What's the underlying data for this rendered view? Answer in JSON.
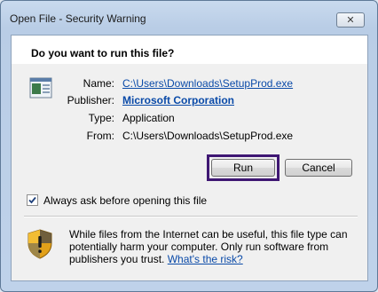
{
  "window": {
    "title": "Open File - Security Warning",
    "close_glyph": "✕"
  },
  "header": {
    "question": "Do you want to run this file?"
  },
  "file_info": {
    "icon": "application-file-icon",
    "name_label": "Name:",
    "name_value": "C:\\Users\\Downloads\\SetupProd.exe",
    "publisher_label": "Publisher:",
    "publisher_value": "Microsoft Corporation",
    "type_label": "Type:",
    "type_value": "Application",
    "from_label": "From:",
    "from_value": "C:\\Users\\Downloads\\SetupProd.exe"
  },
  "buttons": {
    "run_label": "Run",
    "cancel_label": "Cancel"
  },
  "checkbox": {
    "checked": true,
    "label": "Always ask before opening this file"
  },
  "warning": {
    "icon": "security-shield-warning-icon",
    "text": "While files from the Internet can be useful, this file type can potentially harm your computer. Only run software from publishers you trust.",
    "link_text": "What's the risk?"
  },
  "colors": {
    "link": "#0a4aa8",
    "focus_border": "#3f1773",
    "title_bar": "#bfd2ea"
  }
}
